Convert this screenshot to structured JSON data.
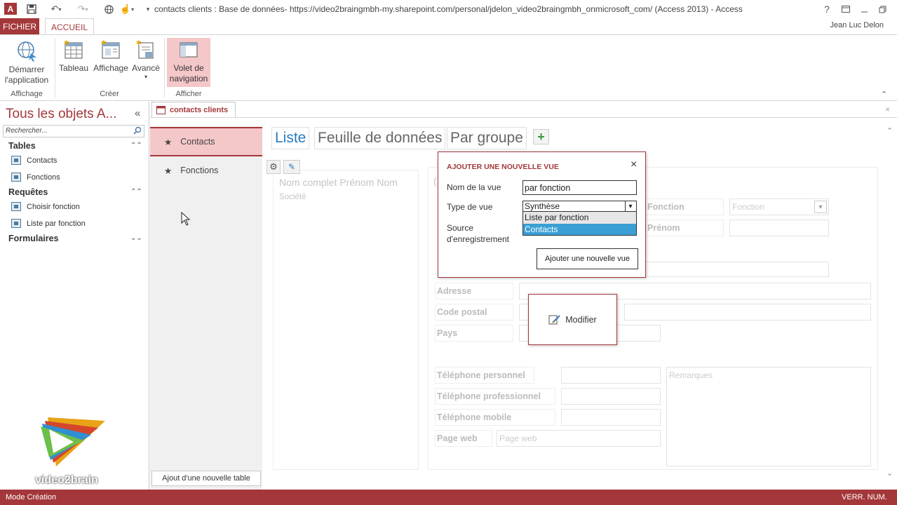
{
  "window": {
    "title": "contacts clients : Base de données- https://video2braingmbh-my.sharepoint.com/personal/jdelon_video2braingmbh_onmicrosoft_com/ (Access 2013) - Access",
    "app_icon": "A",
    "help": "?",
    "user": "Jean Luc Delon"
  },
  "ribbon": {
    "tabs": [
      "FICHIER",
      "ACCUEIL"
    ],
    "buttons": {
      "demarrer": "Démarrer\nl'application",
      "tableau": "Tableau",
      "affichage": "Affichage",
      "avance": "Avancé",
      "volet": "Volet de\nnavigation"
    },
    "groups": {
      "affichage": "Affichage",
      "creer": "Créer",
      "afficher": "Afficher"
    }
  },
  "nav": {
    "title": "Tous les objets A...",
    "collapse": "«",
    "search_placeholder": "Rechercher...",
    "sections": {
      "tables": {
        "label": "Tables",
        "items": [
          "Contacts",
          "Fonctions"
        ]
      },
      "requetes": {
        "label": "Requêtes",
        "items": [
          "Choisir fonction",
          "Liste par fonction"
        ]
      },
      "formulaires": {
        "label": "Formulaires"
      }
    }
  },
  "document": {
    "tab_label": "contacts clients",
    "table_list": [
      "Contacts",
      "Fonctions"
    ],
    "add_table": "Ajout d'une nouvelle table",
    "views": [
      "Liste",
      "Feuille de données",
      "Par groupe"
    ],
    "add_view_symbol": "+",
    "list_placeholder": {
      "line1": "Nom complet Prénom Nom",
      "line2": "Société"
    },
    "form": {
      "fonction_label": "Fonction",
      "fonction_combo": "Fonction",
      "prenom_label": "Prénom",
      "adresse_label": "Adresse",
      "code_postal_label": "Code postal",
      "pays_label": "Pays",
      "tel_perso": "Téléphone personnel",
      "tel_pro": "Téléphone professionnel",
      "tel_mobile": "Téléphone mobile",
      "page_web_label": "Page web",
      "page_web_field": "Page web",
      "remarques": "Remarques"
    }
  },
  "popup": {
    "title": "AJOUTER UNE NOUVELLE VUE",
    "close": "×",
    "nom_label": "Nom de la vue",
    "nom_value": "par fonction",
    "type_label": "Type de vue",
    "type_value": "Synthèse",
    "source_label_line1": "Source",
    "source_label_line2": "d'enregistrement",
    "dropdown_options": [
      "Liste par fonction",
      "Contacts"
    ],
    "submit": "Ajouter une nouvelle vue"
  },
  "modifier": {
    "label": "Modifier"
  },
  "status": {
    "left": "Mode Création",
    "right": "VERR. NUM."
  },
  "logo_text": "video2brain",
  "colors": {
    "accent": "#a4373a",
    "selection": "#3a9fd5"
  }
}
